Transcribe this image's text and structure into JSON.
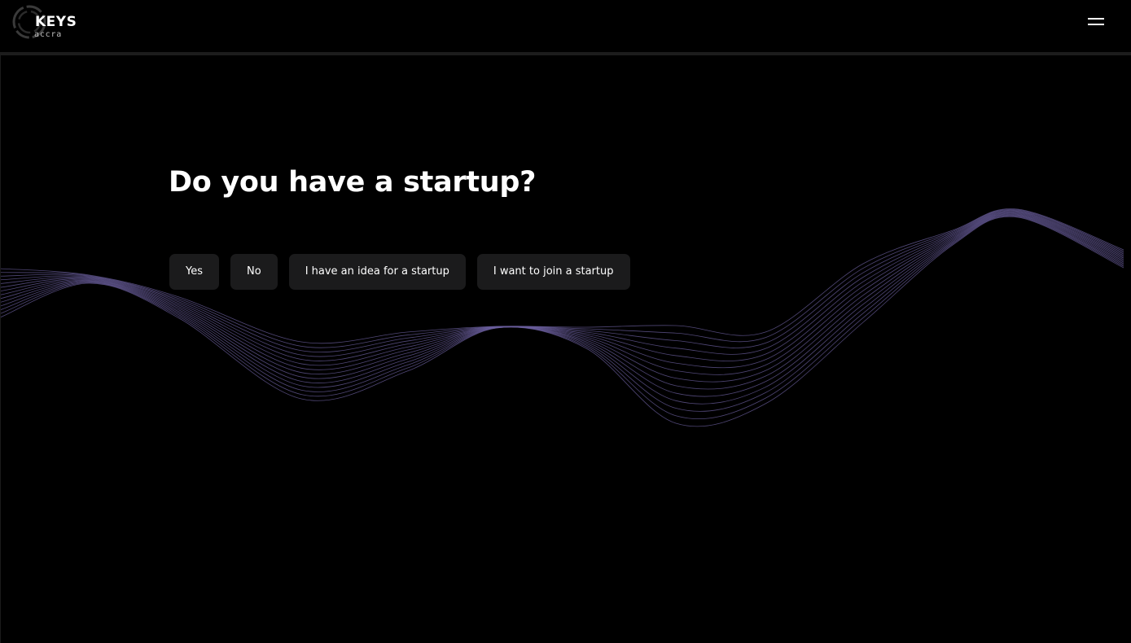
{
  "header": {
    "logo": {
      "title": "KEYS",
      "subtitle": "accra",
      "icon": "keys-ring-logo-icon"
    },
    "menu": {
      "icon": "hamburger-menu-icon"
    }
  },
  "main": {
    "question": "Do you have a startup?",
    "answers": [
      {
        "label": "Yes"
      },
      {
        "label": "No"
      },
      {
        "label": "I have an idea for a startup"
      },
      {
        "label": "I want to join a startup"
      }
    ]
  },
  "colors": {
    "background": "#000000",
    "button_background": "#1b1b1c",
    "text": "#ffffff",
    "wave": "#6b5f9e"
  }
}
